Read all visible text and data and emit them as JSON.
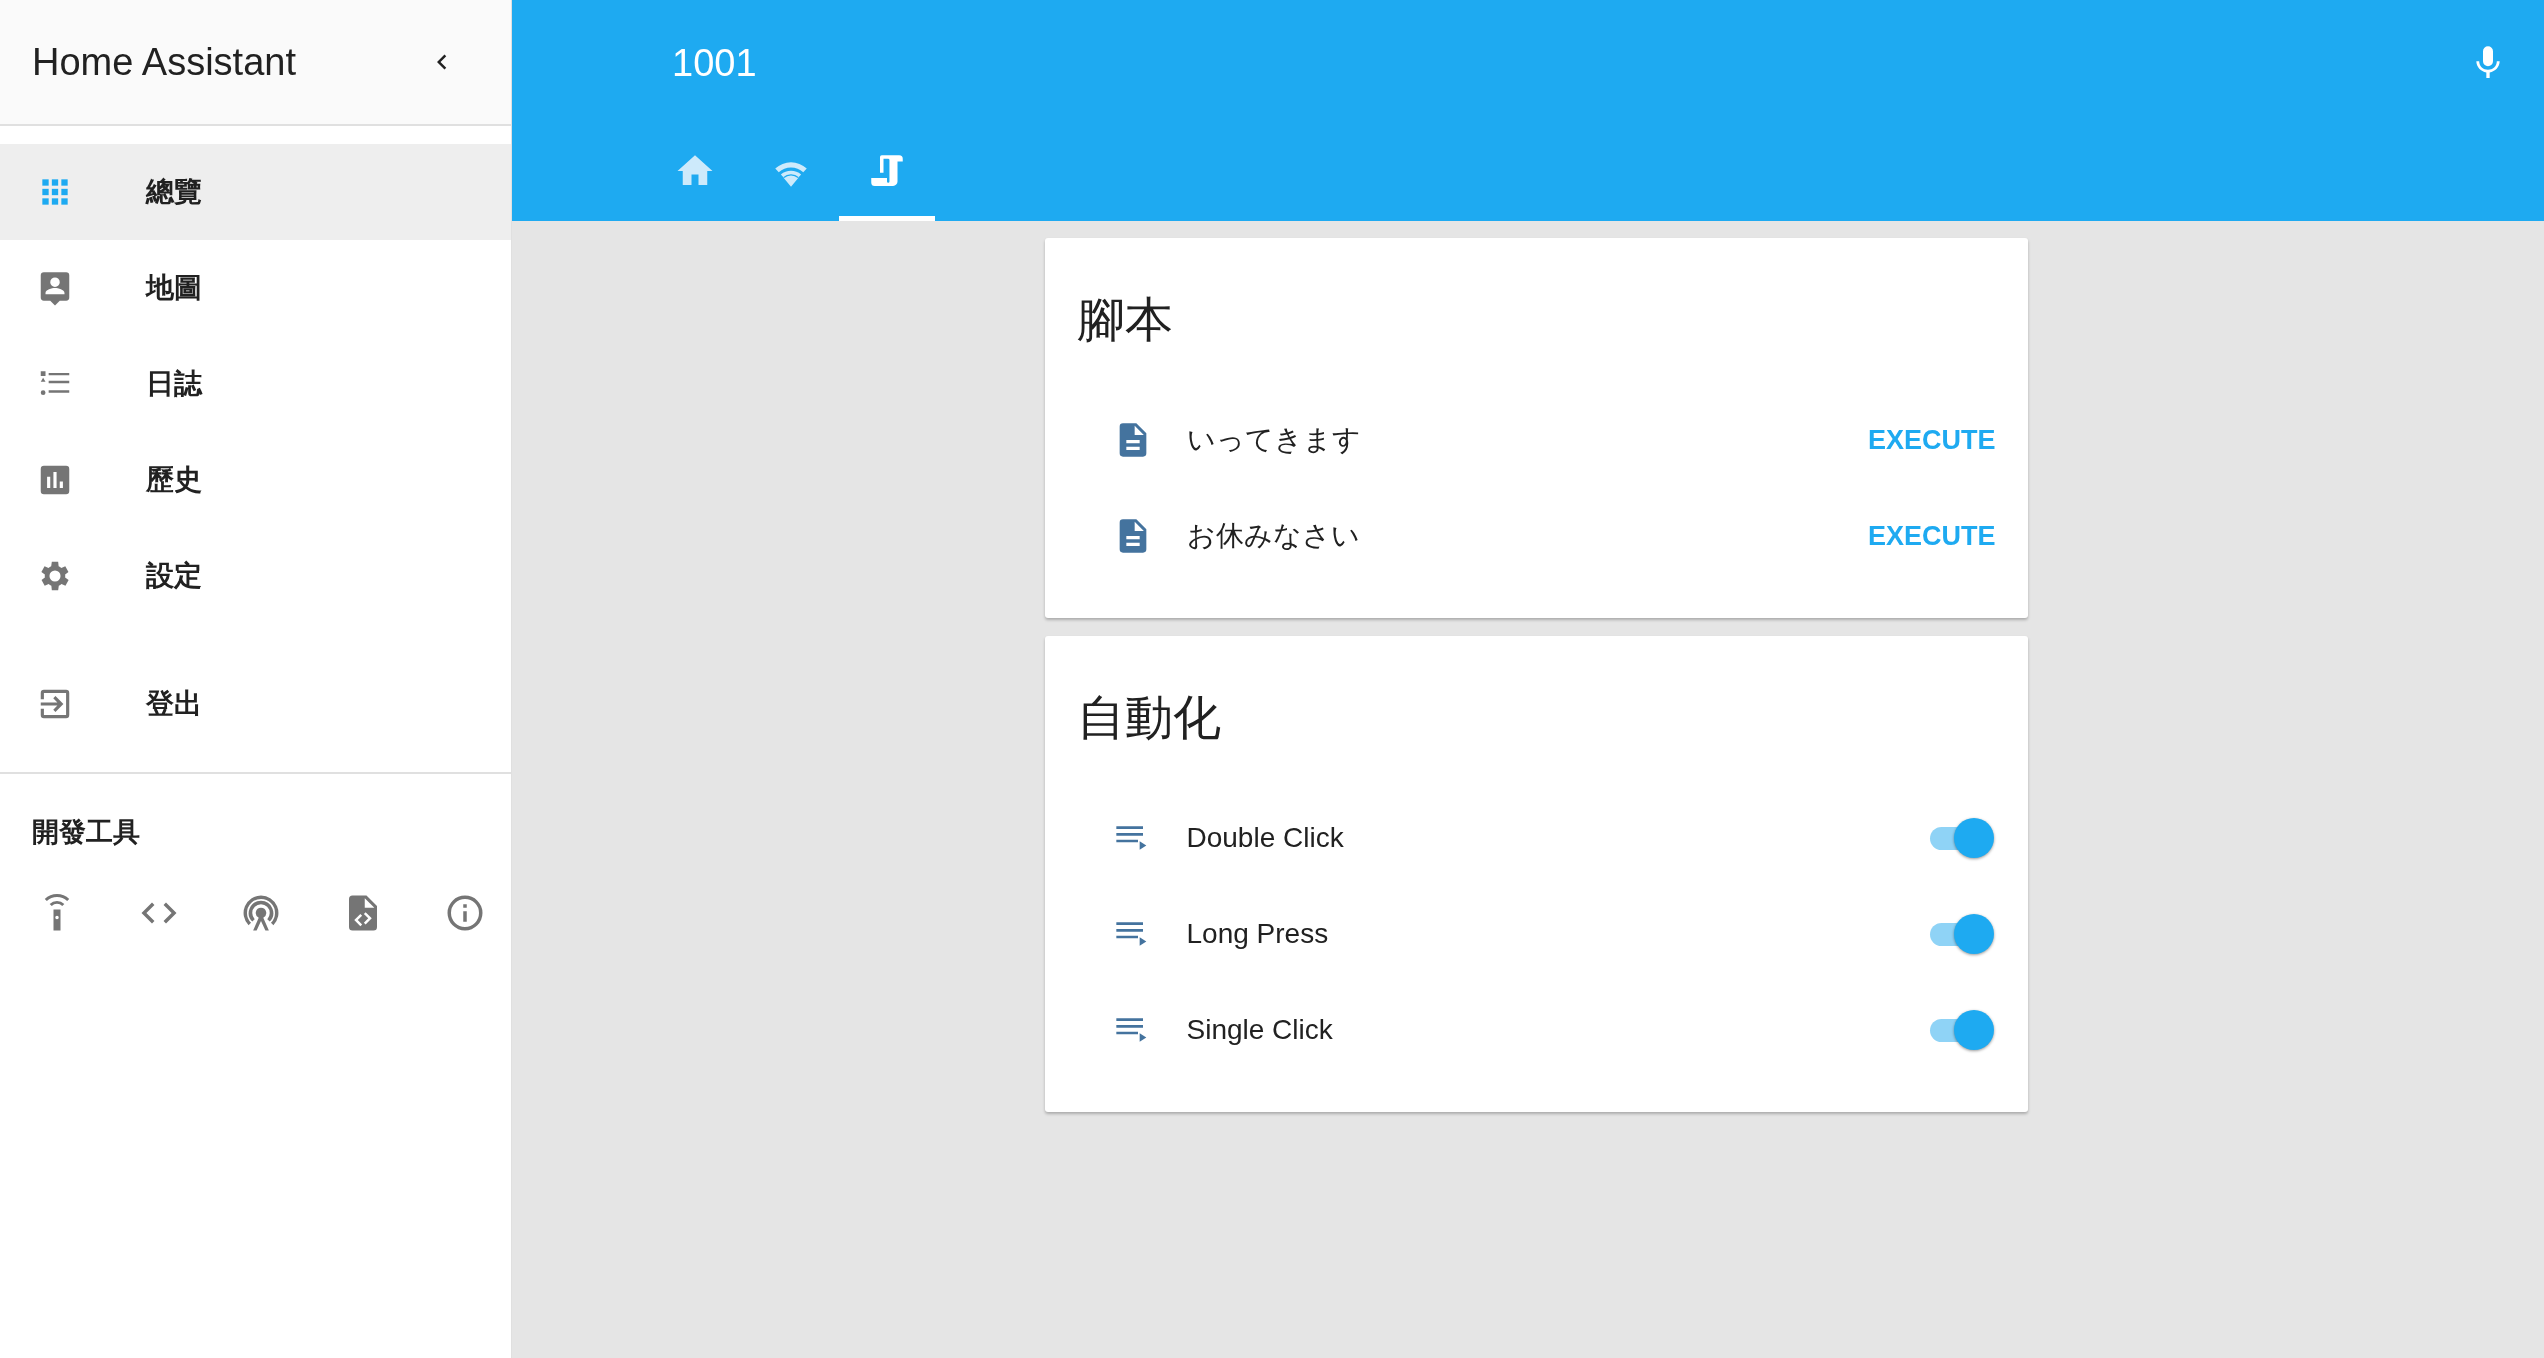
{
  "sidebar": {
    "title": "Home Assistant",
    "items": [
      {
        "label": "總覽",
        "selected": true
      },
      {
        "label": "地圖",
        "selected": false
      },
      {
        "label": "日誌",
        "selected": false
      },
      {
        "label": "歷史",
        "selected": false
      },
      {
        "label": "設定",
        "selected": false
      }
    ],
    "logout": {
      "label": "登出"
    },
    "dev_tools": {
      "title": "開發工具"
    }
  },
  "header": {
    "title": "1001",
    "tabs": [
      {
        "selected": false
      },
      {
        "selected": false
      },
      {
        "selected": true
      }
    ]
  },
  "cards": [
    {
      "title": "腳本",
      "kind": "script",
      "rows": [
        {
          "name": "いってきます",
          "action": "EXECUTE"
        },
        {
          "name": "お休みなさい",
          "action": "EXECUTE"
        }
      ]
    },
    {
      "title": "自動化",
      "kind": "automation",
      "rows": [
        {
          "name": "Double Click",
          "on": true
        },
        {
          "name": "Long Press",
          "on": true
        },
        {
          "name": "Single Click",
          "on": true
        }
      ]
    }
  ]
}
